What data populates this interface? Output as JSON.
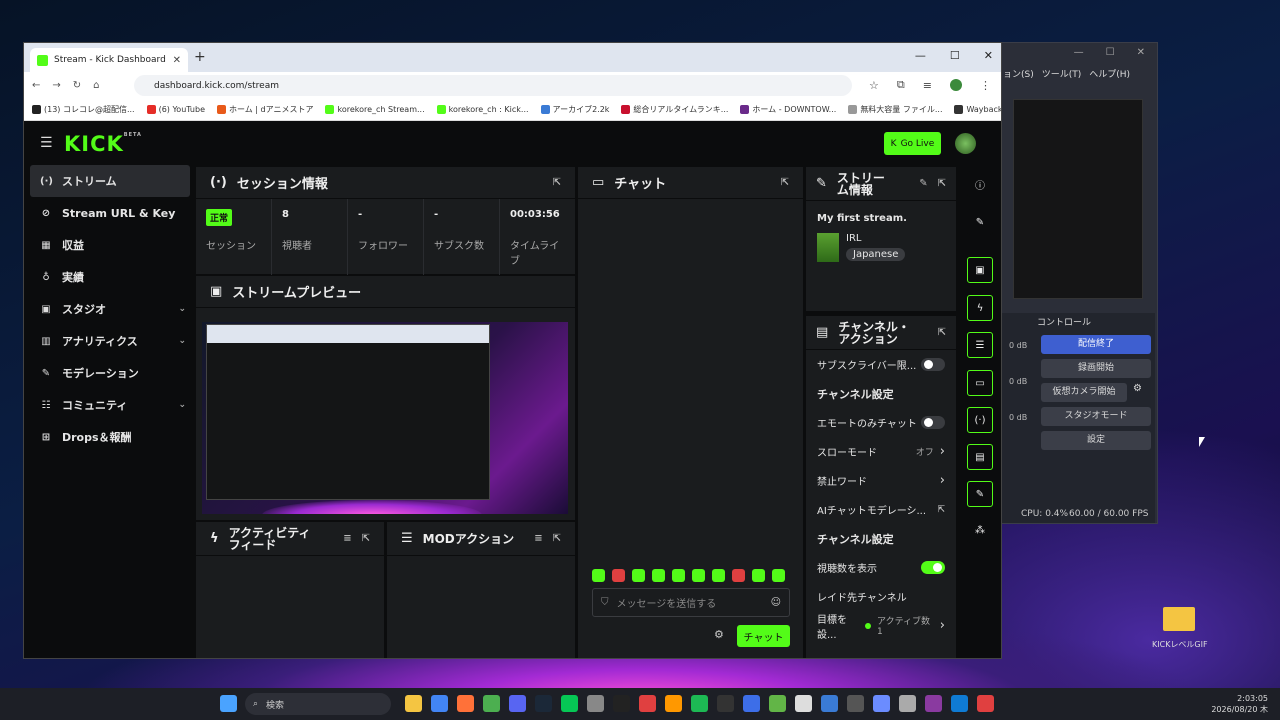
{
  "browser": {
    "tab_title": "Stream - Kick Dashboard",
    "url": "dashboard.kick.com/stream",
    "bookmarks": [
      {
        "label": "(13) コレコレ@超配信...",
        "color": "#222222"
      },
      {
        "label": "(6) YouTube",
        "color": "#e52d27"
      },
      {
        "label": "ホーム | dアニメストア",
        "color": "#e85a1a"
      },
      {
        "label": "korekore_ch Stream...",
        "color": "#53fc18"
      },
      {
        "label": "korekore_ch : Kick...",
        "color": "#53fc18"
      },
      {
        "label": "アーカイブ2.2k",
        "color": "#3a7bd5"
      },
      {
        "label": "総合リアルタイムランキ...",
        "color": "#c8102e"
      },
      {
        "label": "ホーム - DOWNTOW...",
        "color": "#6a2a8a"
      },
      {
        "label": "無料大容量 ファイル...",
        "color": "#999999"
      },
      {
        "label": "Wayback Machine",
        "color": "#333333"
      }
    ]
  },
  "kick": {
    "logo": "KICK",
    "logo_badge": "BETA",
    "go_live": "Go Live",
    "sidebar": [
      {
        "icon": "(·)",
        "label": "ストリーム",
        "active": true
      },
      {
        "icon": "⊘",
        "label": "Stream URL & Key"
      },
      {
        "icon": "▦",
        "label": "収益"
      },
      {
        "icon": "♁",
        "label": "実績"
      },
      {
        "icon": "▣",
        "label": "スタジオ",
        "chevron": "⌄"
      },
      {
        "icon": "▥",
        "label": "アナリティクス",
        "chevron": "⌄"
      },
      {
        "icon": "✎",
        "label": "モデレーション"
      },
      {
        "icon": "☷",
        "label": "コミュニティ",
        "chevron": "⌄"
      },
      {
        "icon": "⊞",
        "label": "Drops＆報酬"
      }
    ],
    "session": {
      "title": "セッション情報",
      "stats": [
        {
          "value": "正常",
          "label": "セッション",
          "badge": true
        },
        {
          "value": "8",
          "label": "視聴者"
        },
        {
          "value": "-",
          "label": "フォロワー"
        },
        {
          "value": "-",
          "label": "サブスク数"
        },
        {
          "value": "00:03:56",
          "label": "タイムライブ"
        }
      ]
    },
    "preview": {
      "title": "ストリームプレビュー"
    },
    "activity": {
      "title": "アクティビティフィード"
    },
    "mod": {
      "title": "MODアクション"
    },
    "chat": {
      "title": "チャット",
      "placeholder": "メッセージを送信する",
      "send": "チャット"
    },
    "stream_info": {
      "title": "ストリーム情報",
      "stream_title": "My first stream.",
      "category": "IRL",
      "language": "Japanese"
    },
    "channel_actions": {
      "title": "チャンネル・アクション",
      "rows": [
        {
          "label": "サブスクライバー限...",
          "kind": "toggle",
          "on": false
        },
        {
          "label": "チャンネル設定",
          "kind": "head"
        },
        {
          "label": "エモートのみチャット",
          "kind": "toggle",
          "on": false
        },
        {
          "label": "スローモード",
          "kind": "link",
          "value": "オフ"
        },
        {
          "label": "禁止ワード",
          "kind": "link"
        },
        {
          "label": "AIチャットモデレーシ...",
          "kind": "external"
        },
        {
          "label": "チャンネル設定",
          "kind": "head"
        },
        {
          "label": "視聴数を表示",
          "kind": "toggle",
          "on": true
        },
        {
          "label": "レイド先チャンネル",
          "kind": "plain"
        },
        {
          "label": "目標を設...",
          "kind": "link",
          "value": "アクティブ数1"
        }
      ]
    }
  },
  "obs": {
    "menu": [
      "ョン(S)",
      "ツール(T)",
      "ヘルプ(H)"
    ],
    "controls_title": "コントロール",
    "controls": [
      {
        "label": "配信終了",
        "active": true
      },
      {
        "label": "録画開始"
      },
      {
        "label": "仮想カメラ開始"
      },
      {
        "label": "スタジオモード"
      },
      {
        "label": "設定"
      }
    ],
    "cpu": "CPU: 0.4%",
    "fps": "60.00 / 60.00 FPS",
    "db": [
      "0 dB",
      "0 dB",
      "0 dB"
    ]
  },
  "desktop": {
    "folder_label": "KICKレベルGIF"
  },
  "taskbar": {
    "search": "検索",
    "time": "2:03:05",
    "date": "2026/08/20 木"
  },
  "colors": {
    "accent": "#53fc18",
    "panel": "#1a1c1e",
    "obs_active": "#3e5fd0"
  }
}
